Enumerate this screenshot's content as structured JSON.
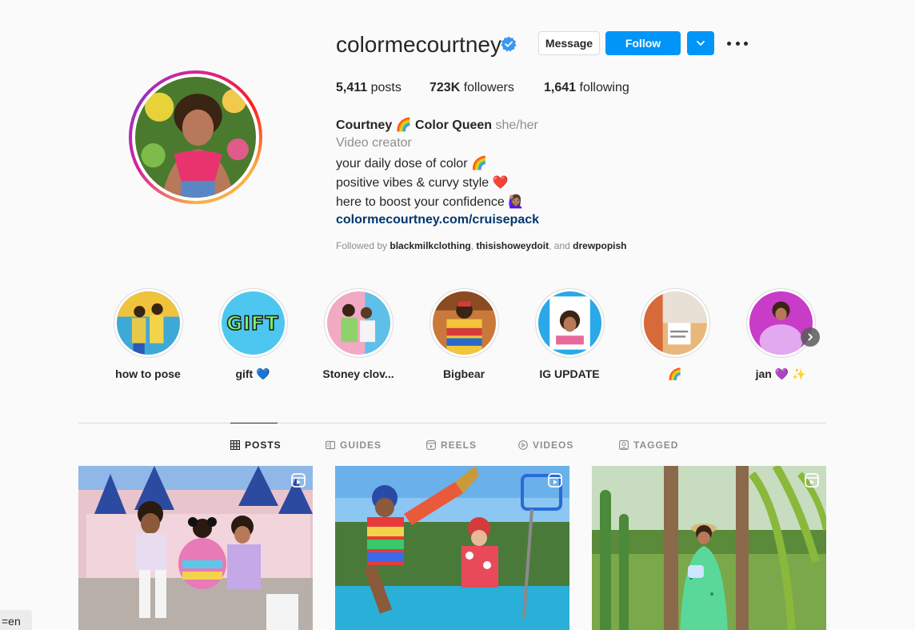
{
  "profile": {
    "username": "colormecourtney",
    "verified_icon": "verified-badge-icon",
    "message_label": "Message",
    "follow_label": "Follow",
    "stats": {
      "posts_count": "5,411",
      "posts_label": "posts",
      "followers_count": "723K",
      "followers_label": "followers",
      "following_count": "1,641",
      "following_label": "following"
    },
    "bio": {
      "name": "Courtney 🌈 Color Queen",
      "pronouns": "she/her",
      "category": "Video creator",
      "line1": "your daily dose of color 🌈",
      "line2": "positive vibes & curvy style ❤️",
      "line3": "here to boost your confidence 🙋🏽‍♀️",
      "link": "colormecourtney.com/cruisepack"
    },
    "followed_by": {
      "prefix": "Followed by",
      "user1": "blackmilkclothing",
      "sep1": ",",
      "user2": "thisishoweydoit",
      "sep2": ", and",
      "user3": "drewpopish"
    }
  },
  "highlights": [
    {
      "label": "how to pose"
    },
    {
      "label": "gift 💙"
    },
    {
      "label": "Stoney clov..."
    },
    {
      "label": "Bigbear"
    },
    {
      "label": "IG UPDATE"
    },
    {
      "label": "🌈"
    },
    {
      "label": "jan 💜 ✨"
    }
  ],
  "highlight_gift_text": "GIFT",
  "tabs": [
    {
      "label": "POSTS",
      "icon": "grid-icon",
      "active": true
    },
    {
      "label": "GUIDES",
      "icon": "guides-icon",
      "active": false
    },
    {
      "label": "REELS",
      "icon": "reels-icon",
      "active": false
    },
    {
      "label": "VIDEOS",
      "icon": "play-circle-icon",
      "active": false
    },
    {
      "label": "TAGGED",
      "icon": "tagged-icon",
      "active": false
    }
  ],
  "posts": [
    {
      "icon": "reel-icon"
    },
    {
      "icon": "reel-icon"
    },
    {
      "icon": "reel-icon"
    }
  ],
  "lang_hint": "=en",
  "colors": {
    "accent": "#0095f6",
    "link": "#00376b",
    "muted": "#8e8e8e",
    "border": "#dbdbdb",
    "background": "#fafafa"
  }
}
